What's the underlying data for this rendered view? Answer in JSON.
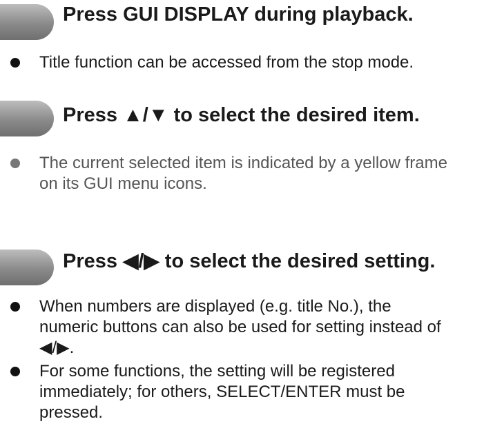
{
  "steps": [
    {
      "title": "Press GUI DISPLAY during playback.",
      "bullets": [
        "Title function can be accessed from the stop mode."
      ]
    },
    {
      "title": "Press ▲/▼ to select the desired item.",
      "bullets": [
        "The current selected item is indicated by a yellow frame on its GUI menu icons."
      ]
    },
    {
      "title": "Press ◀/▶ to select the desired setting.",
      "bullets": [
        "When numbers are displayed (e.g. title No.), the numeric buttons can also be used for setting instead of ◀/▶.",
        "For some functions, the setting will be registered immediately; for others, SELECT/ENTER must be pressed."
      ]
    }
  ]
}
